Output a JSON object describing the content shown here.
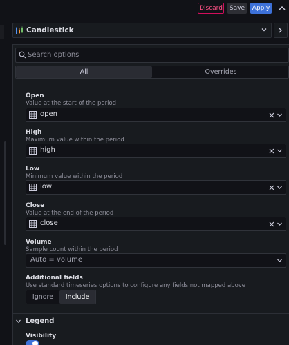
{
  "toolbar": {
    "discard_label": "Discard",
    "save_label": "Save",
    "apply_label": "Apply",
    "accent": "#3d71d9",
    "danger": "#ff5286"
  },
  "viz_picker": {
    "label": "Candlestick",
    "icon": "candlestick-chart-icon"
  },
  "options": {
    "search_placeholder": "Search options",
    "tabs": [
      {
        "label": "All",
        "active": true
      },
      {
        "label": "Overrides",
        "active": false
      }
    ],
    "fields": [
      {
        "title": "Open",
        "desc": "Value at the start of the period",
        "value": "open"
      },
      {
        "title": "High",
        "desc": "Maximum value within the period",
        "value": "high"
      },
      {
        "title": "Low",
        "desc": "Minimum value within the period",
        "value": "low"
      },
      {
        "title": "Close",
        "desc": "Value at the end of the period",
        "value": "close"
      }
    ],
    "volume": {
      "title": "Volume",
      "desc": "Sample count within the period",
      "placeholder": "Auto = volume"
    },
    "additional": {
      "title": "Additional fields",
      "desc": "Use standard timeseries options to configure any fields not mapped above",
      "options": [
        "Ignore",
        "Include"
      ],
      "selected": "Include"
    }
  },
  "legend": {
    "title": "Legend",
    "visibility_label": "Visibility",
    "visibility_on": true
  }
}
